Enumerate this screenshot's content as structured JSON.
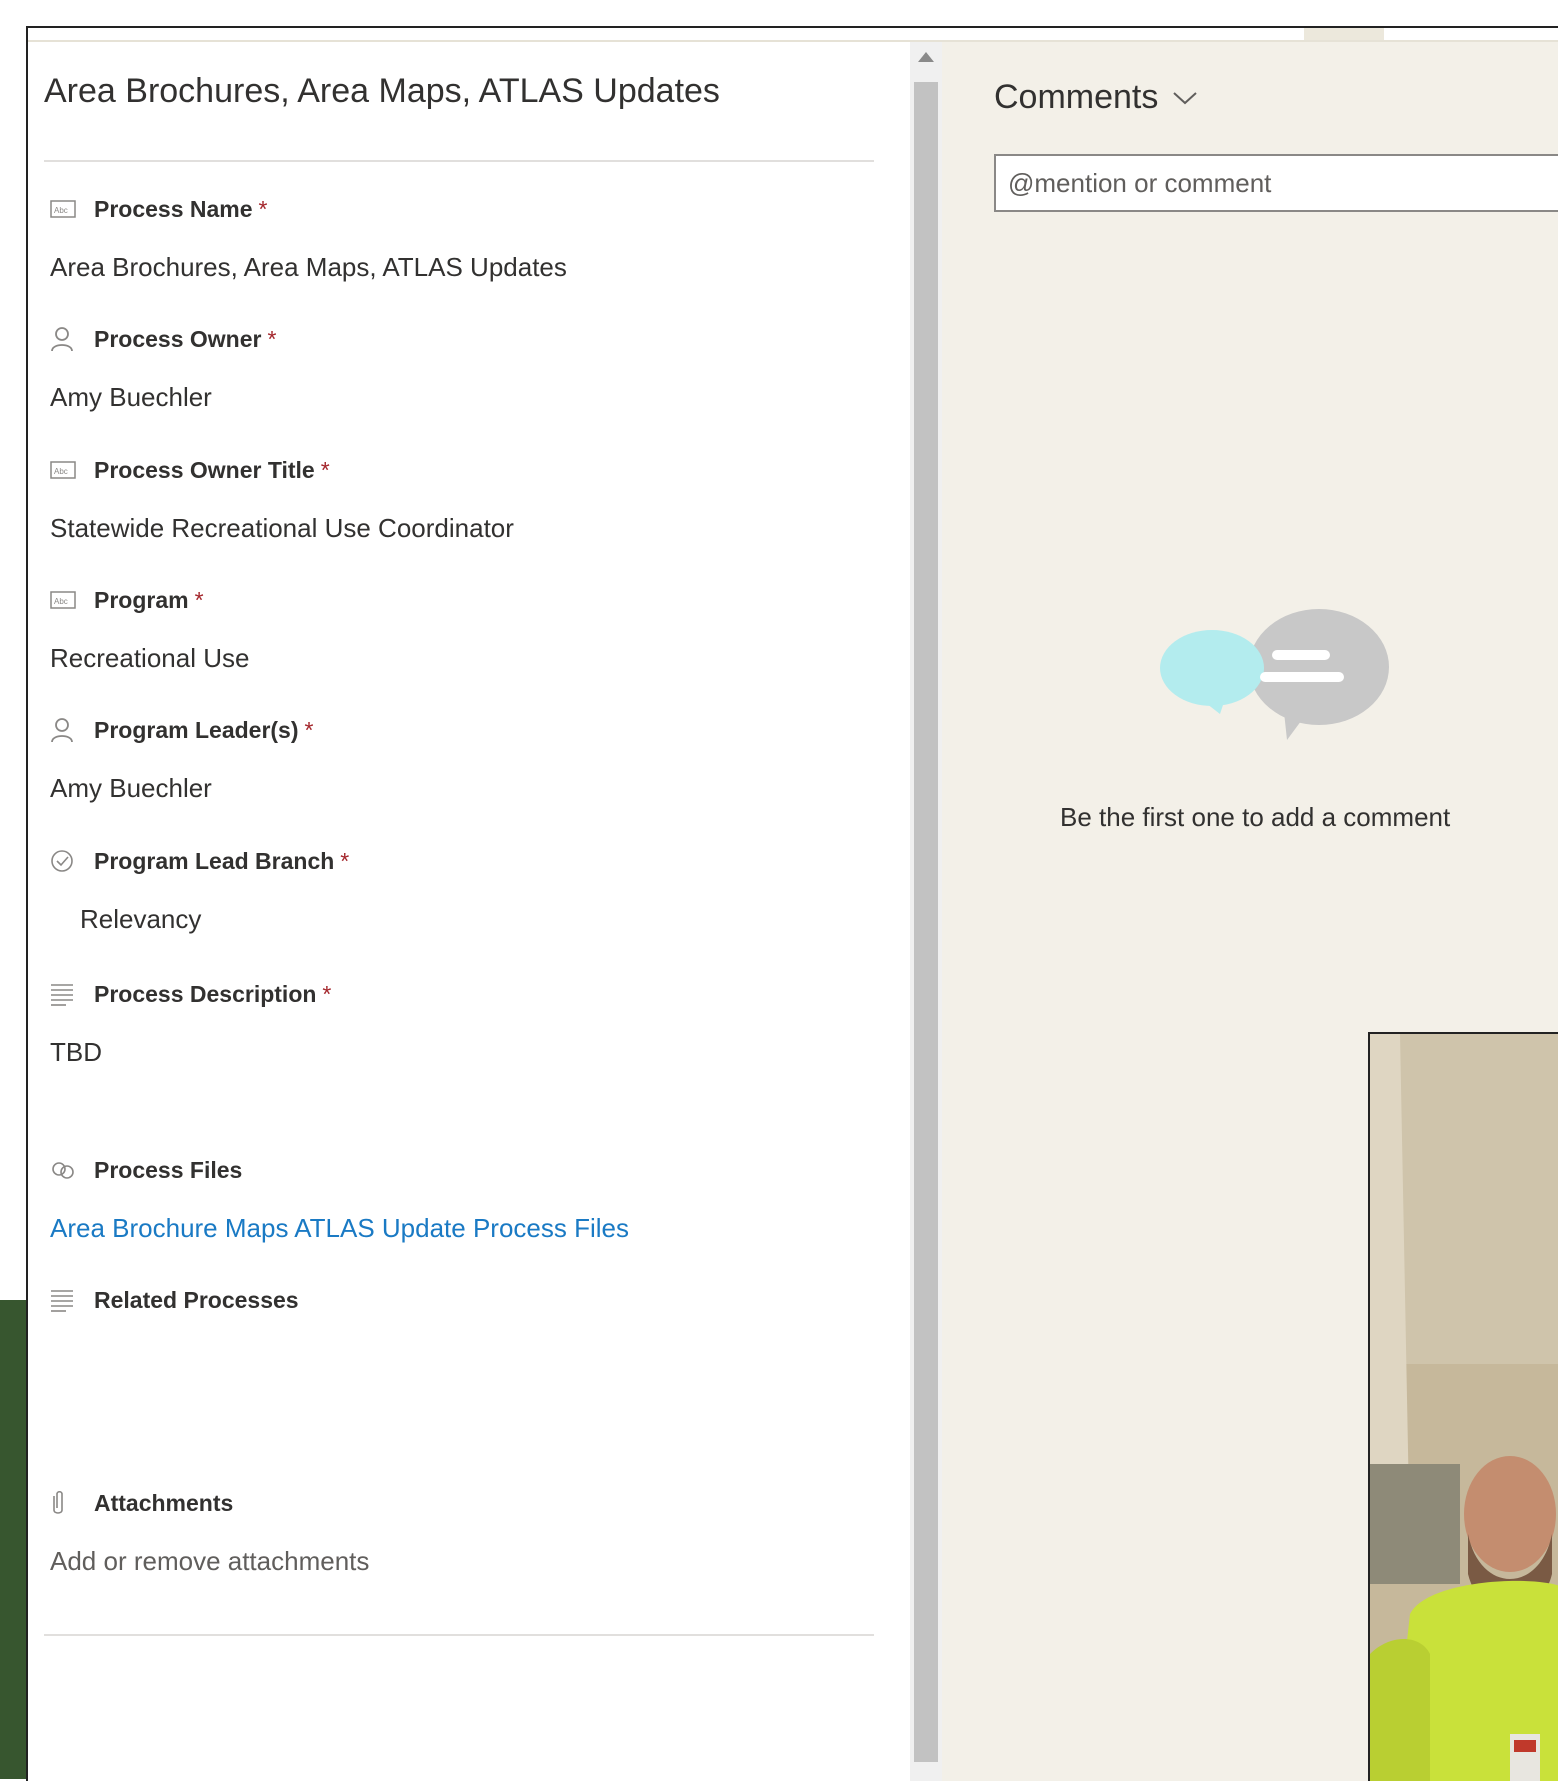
{
  "form": {
    "title": "Area Brochures, Area Maps, ATLAS Updates",
    "required_mark": "*",
    "fields": [
      {
        "icon": "text-field-icon",
        "label": "Process Name",
        "required": true,
        "value": "Area Brochures, Area Maps, ATLAS Updates"
      },
      {
        "icon": "person-icon",
        "label": "Process Owner",
        "required": true,
        "value": "Amy Buechler"
      },
      {
        "icon": "text-field-icon",
        "label": "Process Owner Title",
        "required": true,
        "value": "Statewide Recreational Use Coordinator"
      },
      {
        "icon": "text-field-icon",
        "label": "Program",
        "required": true,
        "value": "Recreational Use"
      },
      {
        "icon": "person-icon",
        "label": "Program Leader(s)",
        "required": true,
        "value": "Amy Buechler"
      },
      {
        "icon": "choice-icon",
        "label": "Program Lead Branch",
        "required": true,
        "value": "Relevancy"
      },
      {
        "icon": "multiline-icon",
        "label": "Process Description",
        "required": true,
        "value": "TBD"
      },
      {
        "icon": "link-icon",
        "label": "Process Files",
        "required": false,
        "value": "Area Brochure Maps ATLAS Update Process Files"
      },
      {
        "icon": "multiline-icon",
        "label": "Related Processes",
        "required": false,
        "value": ""
      },
      {
        "icon": "paperclip-icon",
        "label": "Attachments",
        "required": false,
        "value": "Add or remove attachments"
      }
    ]
  },
  "comments": {
    "title": "Comments",
    "placeholder": "@mention or comment",
    "empty_message": "Be the first one to add a comment"
  },
  "colors": {
    "accent_link": "#1a7ac4",
    "required": "#a4262c",
    "comments_bg": "#f3f0e8",
    "bubble_cyan": "#b3ecee",
    "bubble_gray": "#c8c8c8",
    "side_green": "#37562f"
  }
}
